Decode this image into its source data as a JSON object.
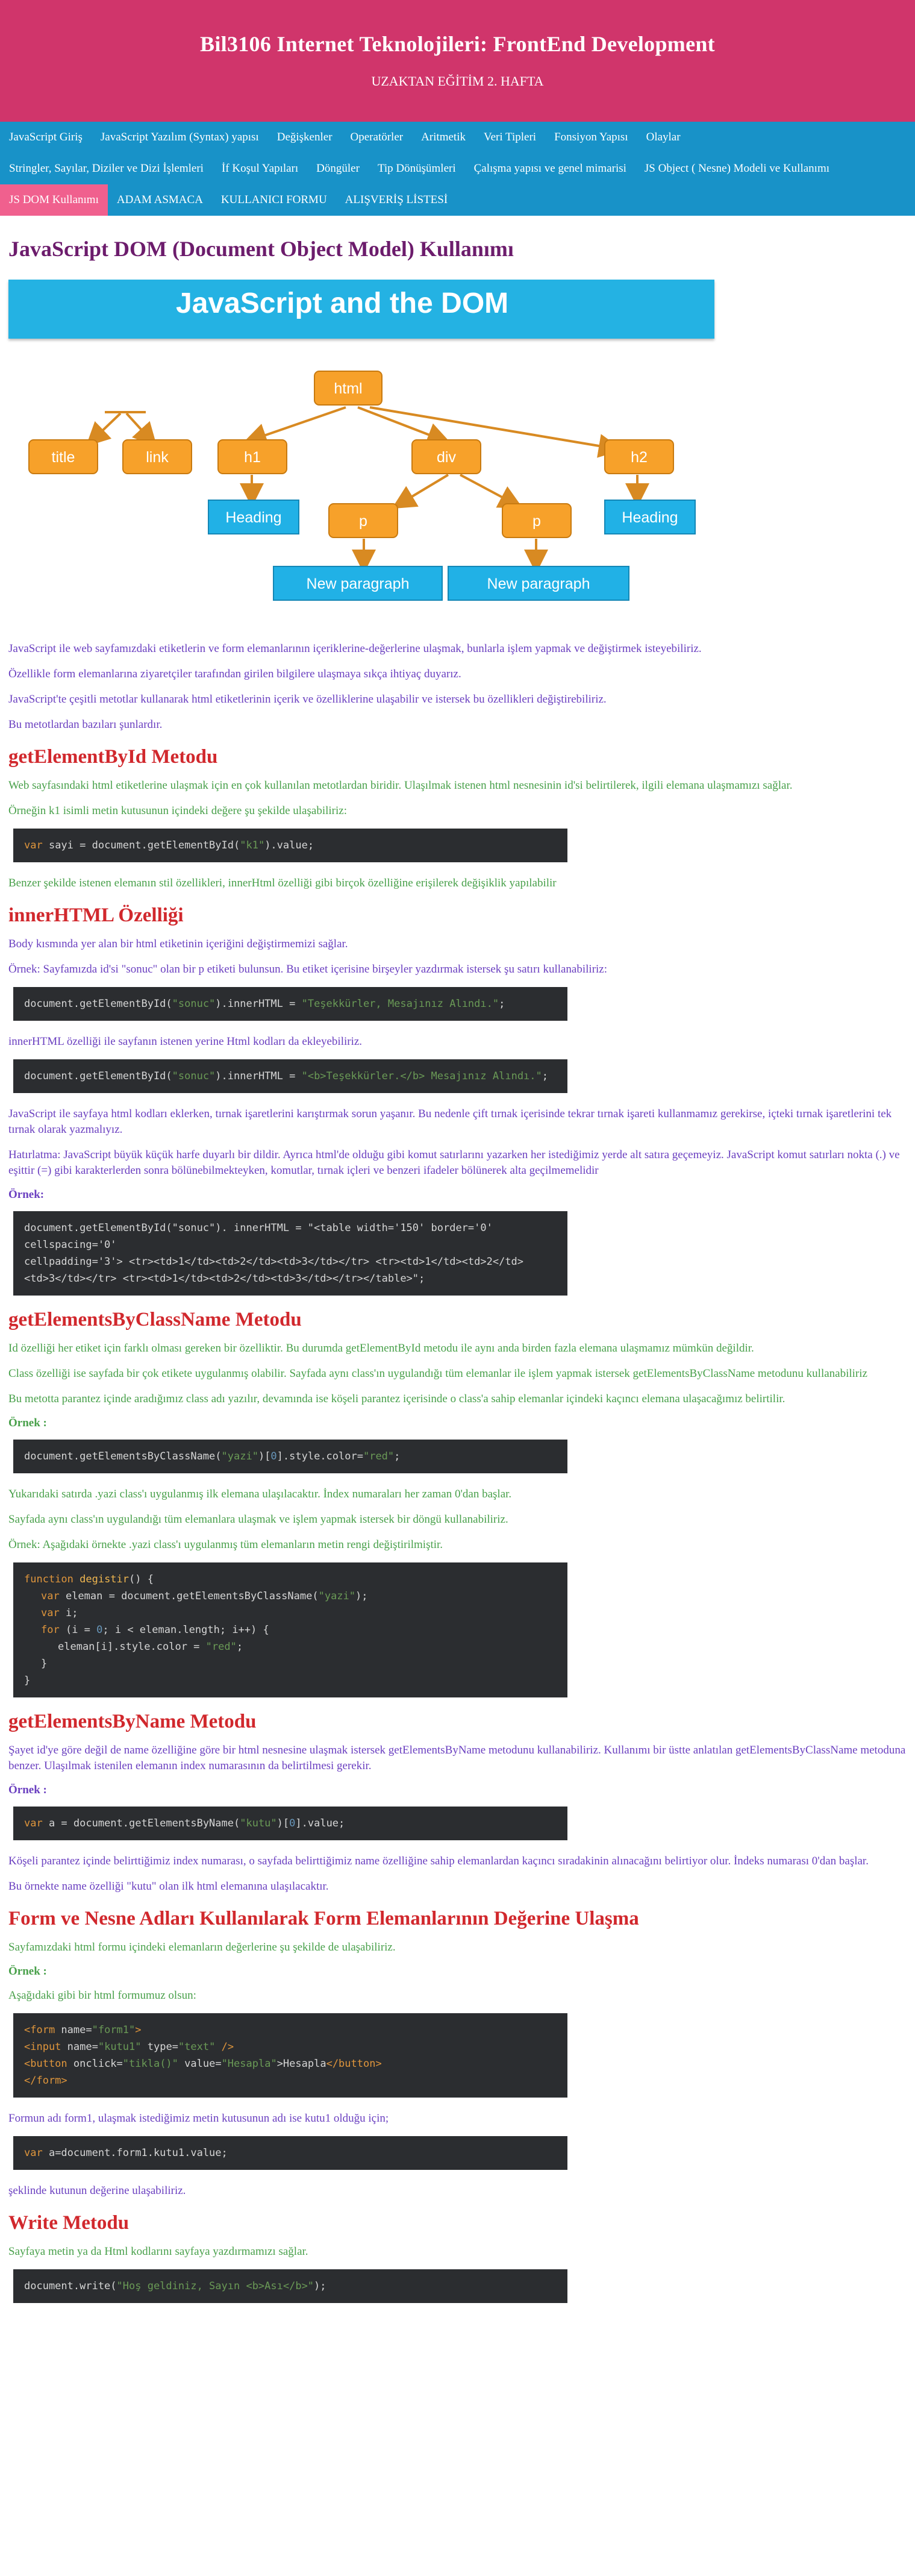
{
  "header": {
    "title": "Bil3106 Internet Teknolojileri: FrontEnd Development",
    "subtitle": "UZAKTAN EĞİTİM 2. HAFTA"
  },
  "nav": {
    "row1": [
      "JavaScript Giriş",
      "JavaScript Yazılım (Syntax) yapısı",
      "Değişkenler",
      "Operatörler",
      "Aritmetik",
      "Veri Tipleri",
      "Fonsiyon Yapısı",
      "Olaylar"
    ],
    "row2": [
      "Stringler, Sayılar, Diziler ve Dizi İşlemleri",
      "İf Koşul Yapıları",
      "Döngüler",
      "Tip Dönüşümleri",
      "Çalışma yapısı ve genel mimarisi",
      "JS Object ( Nesne) Modeli ve Kullanımı"
    ],
    "row3": [
      "JS DOM Kullanımı",
      "ADAM ASMACA",
      "KULLANICI FORMU",
      "ALIŞVERİŞ LİSTESİ"
    ],
    "active": "JS DOM Kullanımı"
  },
  "page_title": "JavaScript DOM (Document Object Model) Kullanımı",
  "diagram": {
    "banner": "JavaScript and the DOM",
    "nodes": {
      "html": "html",
      "title": "title",
      "link": "link",
      "h1": "h1",
      "div": "div",
      "h2": "h2",
      "heading1": "Heading",
      "p1": "p",
      "p2": "p",
      "heading2": "Heading",
      "np1": "New paragraph",
      "np2": "New paragraph"
    },
    "colors": {
      "orange": "#f7a12a",
      "blue": "#21b1e6"
    }
  },
  "intro": [
    "JavaScript ile web sayfamızdaki etiketlerin ve form elemanlarının içeriklerine-değerlerine ulaşmak, bunlarla işlem yapmak ve değiştirmek isteyebiliriz.",
    "Özellikle form elemanlarına ziyaretçiler tarafından girilen bilgilere ulaşmaya sıkça ihtiyaç duyarız.",
    "JavaScript'te çeşitli metotlar kullanarak html etiketlerinin içerik ve özelliklerine ulaşabilir ve istersek bu özellikleri değiştirebiliriz.",
    "Bu metotlardan bazıları şunlardır."
  ],
  "s1": {
    "title": "getElementById Metodu",
    "p1": "Web sayfasındaki html etiketlerine ulaşmak için en çok kullanılan metotlardan biridir. Ulaşılmak istenen html nesnesinin id'si belirtilerek, ilgili elemana ulaşmamızı sağlar.",
    "p2": "Örneğin k1 isimli metin kutusunun içindeki değere şu şekilde ulaşabiliriz:",
    "code": {
      "kw": "var",
      "a": " sayi = document.getElementById(",
      "s": "\"k1\"",
      "b": ").value;"
    },
    "p3": "Benzer şekilde istenen elemanın stil özellikleri, innerHtml özelliği gibi birçok özelliğine erişilerek değişiklik yapılabilir"
  },
  "s2": {
    "title": "innerHTML Özelliği",
    "p1": "Body kısmında yer alan bir html etiketinin içeriğini değiştirmemizi sağlar.",
    "p2": "Örnek: Sayfamızda id'si \"sonuc\" olan bir p etiketi bulunsun. Bu etiket içerisine birşeyler yazdırmak istersek şu satırı kullanabiliriz:",
    "code1": {
      "a": "document.getElementById(",
      "s1": "\"sonuc\"",
      "b": ").innerHTML = ",
      "s2": "\"Teşekkürler, Mesajınız Alındı.\"",
      "c": ";"
    },
    "p3": "innerHTML özelliği ile sayfanın istenen yerine Html kodları da ekleyebiliriz.",
    "code2": {
      "a": "document.getElementById(",
      "s1": "\"sonuc\"",
      "b": ").innerHTML = ",
      "s2": "\"<b>Teşekkürler.</b> Mesajınız Alındı.\"",
      "c": ";"
    },
    "p4": "JavaScript ile sayfaya html kodları eklerken, tırnak işaretlerini karıştırmak sorun yaşanır. Bu nedenle çift tırnak içerisinde tekrar tırnak işareti kullanmamız gerekirse, içteki tırnak işaretlerini tek tırnak olarak yazmalıyız.",
    "p5": "Hatırlatma: JavaScript büyük küçük harfe duyarlı bir dildir. Ayrıca html'de olduğu gibi komut satırlarını yazarken her istediğimiz yerde alt satıra geçemeyiz. JavaScript komut satırları nokta (.) ve eşittir (=) gibi karakterlerden sonra bölünebilmekteyken, komutlar, tırnak içleri ve benzeri ifadeler bölünerek alta geçilmemelidir",
    "ornek": "Örnek:",
    "code3_l1": "document.getElementById(\"sonuc\"). innerHTML = \"<table width='150' border='0' cellspacing='0'",
    "code3_l2": "cellpadding='3'> <tr><td>1</td><td>2</td><td>3</td></tr> <tr><td>1</td><td>2</td>",
    "code3_l3": "<td>3</td></tr> <tr><td>1</td><td>2</td><td>3</td></tr></table>\";"
  },
  "s3": {
    "title": "getElementsByClassName Metodu",
    "p1": "Id özelliği her etiket için farklı olması gereken bir özelliktir. Bu durumda getElementById metodu ile aynı anda birden fazla elemana ulaşmamız mümkün değildir.",
    "p2": "Class özelliği ise sayfada bir çok etikete uygulanmış olabilir. Sayfada aynı class'ın uygulandığı tüm elemanlar ile işlem yapmak istersek getElementsByClassName metodunu kullanabiliriz",
    "p3": "Bu metotta parantez içinde aradığımız class adı yazılır, devamında ise köşeli parantez içerisinde o class'a sahip elemanlar içindeki kaçıncı elemana ulaşacağımız belirtilir.",
    "ornek": "Örnek :",
    "code1": {
      "a": "document.getElementsByClassName(",
      "s1": "\"yazi\"",
      "b": ")[",
      "n": "0",
      "c": "].style.color=",
      "s2": "\"red\"",
      "d": ";"
    },
    "p4": "Yukarıdaki satırda .yazi class'ı uygulanmış ilk elemana ulaşılacaktır. İndex numaraları her zaman 0'dan başlar.",
    "p5": "Sayfada aynı class'ın uygulandığı tüm elemanlara ulaşmak ve işlem yapmak istersek bir döngü kullanabiliriz.",
    "p6": "Örnek: Aşağıdaki örnekte .yazi class'ı uygulanmış tüm elemanların metin rengi değiştirilmiştir.",
    "code2": {
      "l1_kw": "function",
      "l1_fn": " degistir",
      "l1_b": "() {",
      "l2_kw": "var",
      "l2_a": " eleman = document.getElementsByClassName(",
      "l2_s": "\"yazi\"",
      "l2_b": ");",
      "l3_kw": "var",
      "l3_a": " i;",
      "l4_kw": "for",
      "l4_a": " (i = ",
      "l4_n": "0",
      "l4_b": "; i < eleman.length; i++) {",
      "l5_a": "eleman[i].style.color = ",
      "l5_s": "\"red\"",
      "l5_b": ";",
      "l6": "}",
      "l7": "}"
    }
  },
  "s4": {
    "title": "getElementsByName Metodu",
    "p1": "Şayet id'ye göre değil de name özelliğine göre bir html nesnesine ulaşmak istersek getElementsByName metodunu kullanabiliriz. Kullanımı bir üstte anlatılan getElementsByClassName metoduna benzer. Ulaşılmak istenilen elemanın index numarasının da belirtilmesi gerekir.",
    "ornek": "Örnek :",
    "code": {
      "kw": "var",
      "a": " a = document.getElementsByName(",
      "s": "\"kutu\"",
      "b": ")[",
      "n": "0",
      "c": "].value;"
    },
    "p2": "Köşeli parantez içinde belirttiğimiz index numarası, o sayfada belirttiğimiz name özelliğine sahip elemanlardan kaçıncı sıradakinin alınacağını belirtiyor olur. İndeks numarası 0'dan başlar.",
    "p3": "Bu örnekte name özelliği \"kutu\" olan ilk html elemanına ulaşılacaktır."
  },
  "s5": {
    "title": "Form ve Nesne Adları Kullanılarak Form Elemanlarının Değerine Ulaşma",
    "p1": "Sayfamızdaki html formu içindeki elemanların değerlerine şu şekilde de ulaşabiliriz.",
    "ornek": "Örnek :",
    "p2": "Aşağıdaki gibi bir html formumuz olsun:",
    "code1": {
      "l1_t": "<form",
      "l1_a": " name=",
      "l1_s": "\"form1\"",
      "l1_e": ">",
      "l2_t": "<input",
      "l2_a": " name=",
      "l2_s": "\"kutu1\"",
      "l2_b": " type=",
      "l2_s2": "\"text\"",
      "l2_e": " />",
      "l3_t": "<button",
      "l3_a": " onclick=",
      "l3_s": "\"tikla()\"",
      "l3_b": " value=",
      "l3_s2": "\"Hesapla\"",
      "l3_c": ">Hesapla",
      "l3_e": "</button>",
      "l4_t": "</form>"
    },
    "p3": "Formun adı form1, ulaşmak istediğimiz metin kutusunun adı ise kutu1 olduğu için;",
    "code2": {
      "kw": "var",
      "a": " a=document.form1.kutu1.value;"
    },
    "p4": "şeklinde kutunun değerine ulaşabiliriz."
  },
  "s6": {
    "title": "Write Metodu",
    "p1": "Sayfaya metin ya da Html kodlarını sayfaya yazdırmamızı sağlar.",
    "code": {
      "a": "document.write(",
      "s": "\"Hoş geldiniz, Sayın <b>Ası</b>\"",
      "b": ");"
    }
  }
}
